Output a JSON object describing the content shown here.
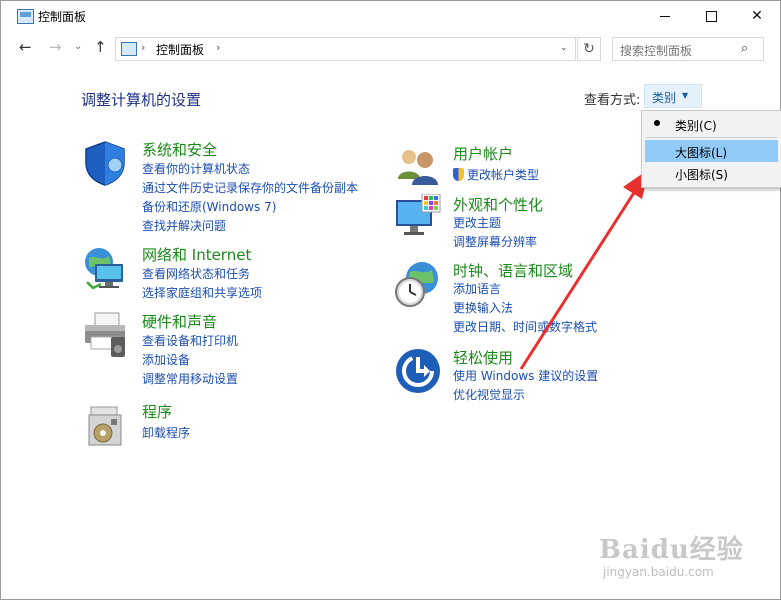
{
  "window": {
    "title": "控制面板"
  },
  "address": {
    "path": "控制面板",
    "search_placeholder": "搜索控制面板"
  },
  "header": {
    "title": "调整计算机的设置",
    "view_by_label": "查看方式:",
    "view_by_value": "类别"
  },
  "view_menu": {
    "options": [
      "类别(C)",
      "大图标(L)",
      "小图标(S)"
    ],
    "selected": "类别(C)",
    "highlighted": "大图标(L)"
  },
  "categories": {
    "system": {
      "title": "系统和安全",
      "links": [
        "查看你的计算机状态",
        "通过文件历史记录保存你的文件备份副本",
        "备份和还原(Windows 7)",
        "查找并解决问题"
      ]
    },
    "network": {
      "title": "网络和 Internet",
      "links": [
        "查看网络状态和任务",
        "选择家庭组和共享选项"
      ]
    },
    "hardware": {
      "title": "硬件和声音",
      "links": [
        "查看设备和打印机",
        "添加设备",
        "调整常用移动设置"
      ]
    },
    "programs": {
      "title": "程序",
      "links": [
        "卸载程序"
      ]
    },
    "users": {
      "title": "用户帐户",
      "links": [
        "更改帐户类型"
      ]
    },
    "appearance": {
      "title": "外观和个性化",
      "links": [
        "更改主题",
        "调整屏幕分辨率"
      ]
    },
    "clock": {
      "title": "时钟、语言和区域",
      "links": [
        "添加语言",
        "更换输入法",
        "更改日期、时间或数字格式"
      ]
    },
    "ease": {
      "title": "轻松使用",
      "links": [
        "使用 Windows 建议的设置",
        "优化视觉显示"
      ]
    }
  },
  "watermark": {
    "main": "Baidu经验",
    "sub": "jingyan.baidu.com"
  },
  "colors": {
    "title_link": "#1e3287",
    "category_title": "#1a8a1a",
    "link": "#1c4fb0",
    "menu_highlight": "#91c9f7",
    "arrow": "#e8312f"
  }
}
